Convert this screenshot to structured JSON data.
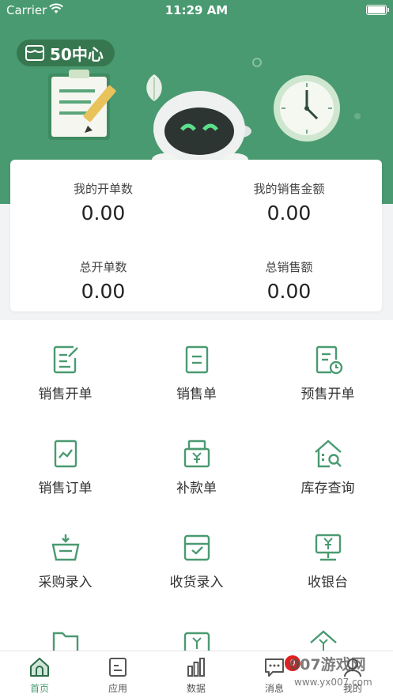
{
  "status_bar": {
    "carrier": "Carrier",
    "time": "11:29 AM"
  },
  "header": {
    "store_name": "50中心"
  },
  "stats": [
    {
      "label": "我的开单数",
      "value": "0.00"
    },
    {
      "label": "我的销售金额",
      "value": "0.00"
    },
    {
      "label": "总开单数",
      "value": "0.00"
    },
    {
      "label": "总销售额",
      "value": "0.00"
    }
  ],
  "grid": [
    {
      "label": "销售开单",
      "icon": "edit-document-icon"
    },
    {
      "label": "销售单",
      "icon": "document-icon"
    },
    {
      "label": "预售开单",
      "icon": "document-clock-icon"
    },
    {
      "label": "销售订单",
      "icon": "chart-document-icon"
    },
    {
      "label": "补款单",
      "icon": "yen-cash-register-icon"
    },
    {
      "label": "库存查询",
      "icon": "warehouse-search-icon"
    },
    {
      "label": "采购录入",
      "icon": "basket-download-icon"
    },
    {
      "label": "收货录入",
      "icon": "box-receive-icon"
    },
    {
      "label": "收银台",
      "icon": "cashier-monitor-icon"
    }
  ],
  "tabbar": {
    "items": [
      {
        "label": "首页",
        "icon": "home-icon"
      },
      {
        "label": "应用",
        "icon": "apps-icon"
      },
      {
        "label": "数据",
        "icon": "bar-chart-icon"
      },
      {
        "label": "消息",
        "icon": "message-icon"
      },
      {
        "label": "我的",
        "icon": "user-icon"
      }
    ],
    "active_index": 0,
    "badge": "0"
  },
  "watermark": {
    "brand": "007游戏网",
    "url": "www.yx007.com"
  },
  "colors": {
    "brand_green": "#4a9a71",
    "dark_green": "#37774f",
    "badge_red": "#e02020"
  }
}
